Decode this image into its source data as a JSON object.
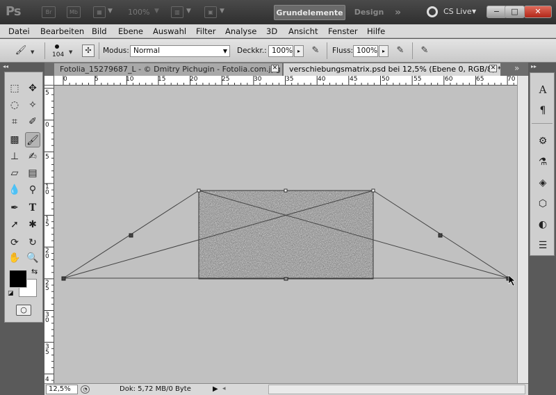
{
  "app": {
    "logo": "Ps",
    "bridge_icon": "Br",
    "minibridge_icon": "Mb",
    "zoom": "100%"
  },
  "workspace": {
    "active": "Grundelemente",
    "other": "Design",
    "more": "»",
    "cs_live": "CS Live"
  },
  "window_buttons": {
    "minimize": "−",
    "restore": "□",
    "close": "✕"
  },
  "menu": [
    "Datei",
    "Bearbeiten",
    "Bild",
    "Ebene",
    "Auswahl",
    "Filter",
    "Analyse",
    "3D",
    "Ansicht",
    "Fenster",
    "Hilfe"
  ],
  "options": {
    "brush_size": "104",
    "mode_label": "Modus:",
    "mode_value": "Normal",
    "opacity_label": "Deckkr.:",
    "opacity_value": "100%",
    "flow_label": "Fluss:",
    "flow_value": "100%"
  },
  "tabs": [
    {
      "label": "Fotolia_15279687_L - © Dmitry Pichugin - Fotolia.com.jpg",
      "active": false
    },
    {
      "label": "verschiebungsmatrix.psd bei 12,5% (Ebene 0, RGB/8) *",
      "active": true
    }
  ],
  "panel_collapse": {
    "left": "◂◂",
    "right": "▸▸",
    "tab_overflow": "»"
  },
  "ruler": {
    "h_labels": [
      "0",
      "5",
      "10",
      "15",
      "20",
      "25",
      "30",
      "35",
      "40",
      "45",
      "50",
      "55",
      "60",
      "65",
      "70"
    ],
    "v_labels": [
      "5",
      "0",
      "5",
      "1 0",
      "1 5",
      "2 0",
      "2 5",
      "3 0",
      "3 5",
      "4"
    ]
  },
  "status": {
    "zoom": "12,5%",
    "doc": "Dok: 5,72 MB/0 Byte"
  },
  "colors": {
    "foreground": "#000000",
    "background": "#ffffff",
    "canvas": "#c1c1c1",
    "accent_close": "#c0392b"
  }
}
